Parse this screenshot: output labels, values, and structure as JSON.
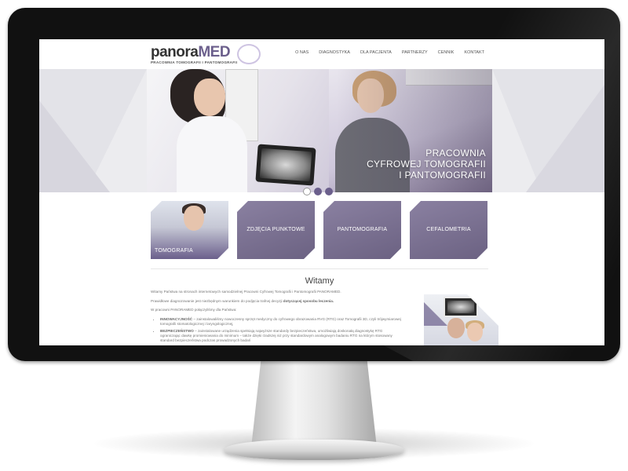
{
  "site": {
    "logo": {
      "main_dark": "panora",
      "main_accent": "MED",
      "tagline": "PRACOWNIA TOMOGRAFII I PANTOMOGRAFII"
    },
    "nav": [
      "O NAS",
      "DIAGNOSTYKA",
      "DLA PACJENTA",
      "PARTNERZY",
      "CENNIK",
      "KONTAKT"
    ]
  },
  "hero": {
    "title_lines": [
      "PRACOWNIA",
      "CYFROWEJ TOMOGRAFII",
      "I PANTOMOGRAFII"
    ],
    "slide_count": 3,
    "active_slide": 1
  },
  "tiles": [
    {
      "label": "TOMOGRAFIA"
    },
    {
      "label": "ZDJĘCIA PUNKTOWE"
    },
    {
      "label": "PANTOMOGRAFIA"
    },
    {
      "label": "CEFALOMETRIA"
    }
  ],
  "content": {
    "title": "Witamy",
    "p1": "Witamy Państwa na stronach internetowych samodzielnej Pracowni Cyfrowej Tomografii i Pantomografii PANORAMED.",
    "p2_start": "Prawidłowe diagnozowanie jest niezbędnym warunkiem do podjęcia trafnej decyzji ",
    "p2_bold": "dotyczącej sposobu leczenia.",
    "p3": "W pracowni PANORAMED połączyliśmy dla Państwa:",
    "bullets": [
      {
        "head": "INNOWACYJNOŚĆ",
        "text": " – zainstalowaliśmy nowoczesny sprzęt medyczny do cyfrowego obrazowania RVG (RTG) oraz Tomografii 3D, czyli trójwymiarowej tomografii stomatologicznej i laryngologicznej,"
      },
      {
        "head": "BEZPIECZEŃSTWO",
        "text": " – zainstalowane urządzenia spełniają najwyższe standardy bezpieczeństwa, umożliwiają doskonałą diagnostykę RTG ograniczając dawkę promieniowania do minimum – także dzięki rzadszej niż przy standardowym analogowym badaniu RTG na którym stosowany standard bezpieczeństwa podczas prowadzonych badań"
      }
    ]
  },
  "colors": {
    "accent": "#6b5f8c",
    "bezel": "#111111"
  }
}
